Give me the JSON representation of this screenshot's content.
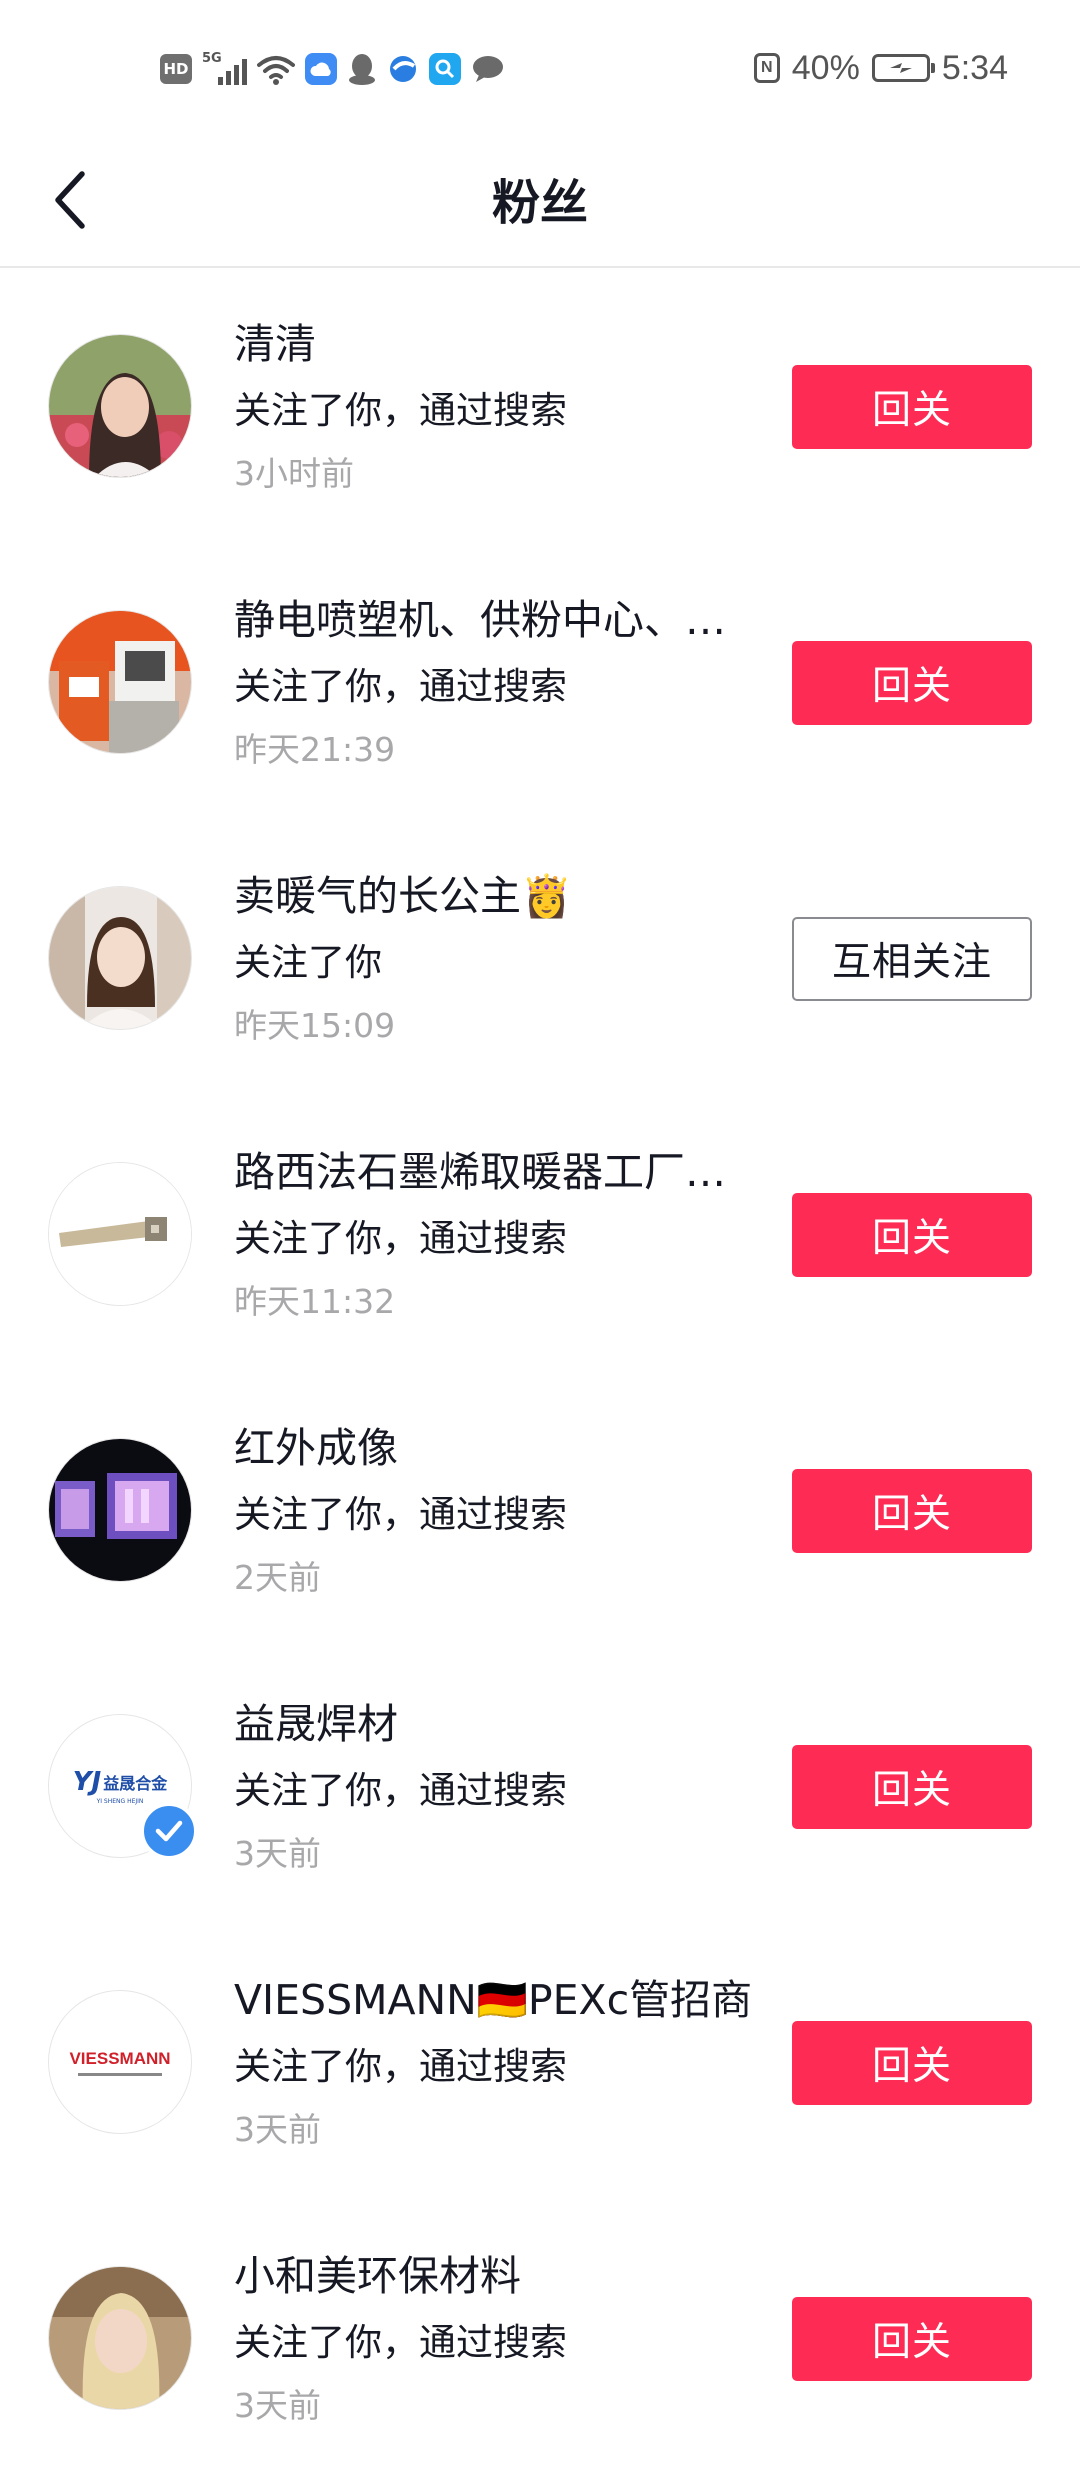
{
  "status_bar": {
    "hd_label": "HD",
    "network_label": "5G",
    "battery_percent": "40%",
    "time": "5:34",
    "nfc_label": "N"
  },
  "nav": {
    "back_icon": "chevron-left-icon",
    "title": "粉丝"
  },
  "colors": {
    "primary_button": "#fe2c55",
    "muted_text": "#a8a8ab",
    "verified_badge": "#3a8ef0"
  },
  "fans": [
    {
      "name": "清清",
      "action": "关注了你，通过搜索",
      "time": "3小时前",
      "button": "回关",
      "button_style": "primary",
      "verified": false
    },
    {
      "name": "静电喷塑机、供粉中心、…",
      "action": "关注了你，通过搜索",
      "time": "昨天21:39",
      "button": "回关",
      "button_style": "primary",
      "verified": false
    },
    {
      "name": "卖暖气的长公主👸",
      "action": "关注了你",
      "time": "昨天15:09",
      "button": "互相关注",
      "button_style": "secondary",
      "verified": false
    },
    {
      "name": "路西法石墨烯取暖器工厂…",
      "action": "关注了你，通过搜索",
      "time": "昨天11:32",
      "button": "回关",
      "button_style": "primary",
      "verified": false
    },
    {
      "name": "红外成像",
      "action": "关注了你，通过搜索",
      "time": "2天前",
      "button": "回关",
      "button_style": "primary",
      "verified": false
    },
    {
      "name": "益晟焊材",
      "action": "关注了你，通过搜索",
      "time": "3天前",
      "button": "回关",
      "button_style": "primary",
      "verified": true,
      "avatar_logo_text": "益晟合金",
      "avatar_logo_sub": "YI SHENG HEJIN"
    },
    {
      "name": "VIESSMANN🇩🇪PEXc管招商",
      "action": "关注了你，通过搜索",
      "time": "3天前",
      "button": "回关",
      "button_style": "primary",
      "verified": false,
      "avatar_logo_text": "VIESSMANN"
    },
    {
      "name": "小和美环保材料",
      "action": "关注了你，通过搜索",
      "time": "3天前",
      "button": "回关",
      "button_style": "primary",
      "verified": false
    }
  ]
}
